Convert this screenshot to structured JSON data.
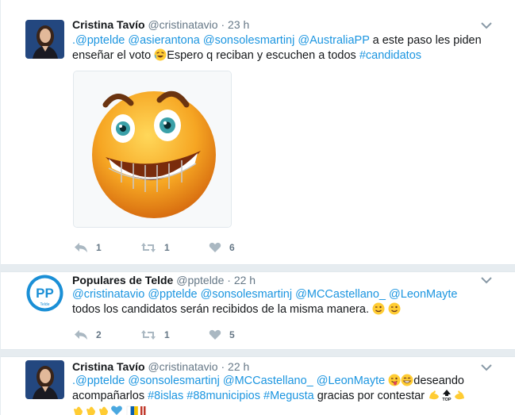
{
  "tweets": [
    {
      "name": "Cristina Tavío",
      "handle": "@cristinatavio",
      "dot": "·",
      "time": "23 h",
      "text_parts": [
        ".@pptelde",
        " ",
        "@asierantona",
        " ",
        "@sonsolesmartinj",
        " ",
        "@AustraliaPP",
        " a este paso les piden enseñar el voto ",
        "Espero q reciban y escuchen a todos ",
        "#candidatos"
      ],
      "reply_count": "1",
      "retweet_count": "1",
      "like_count": "6"
    },
    {
      "name": "Populares de Telde",
      "handle": "@pptelde",
      "dot": "·",
      "time": "22 h",
      "text_parts": [
        "@cristinatavio",
        " ",
        "@pptelde",
        " ",
        "@sonsolesmartinj",
        " ",
        "@MCCastellano_",
        " ",
        "@LeonMayte",
        "todos los candidatos serán recibidos de la misma manera. "
      ],
      "reply_count": "2",
      "retweet_count": "1",
      "like_count": "5",
      "avatar_logo_text": "PP",
      "avatar_logo_sub": "Telde"
    },
    {
      "name": "Cristina Tavío",
      "handle": "@cristinatavio",
      "dot": "·",
      "time": "22 h",
      "text_parts": [
        ".@pptelde",
        " ",
        "@sonsolesmartinj",
        " ",
        "@MCCastellano_",
        " ",
        "@LeonMayte",
        " ",
        "deseando",
        "acompañarlos ",
        "#8islas",
        " ",
        "#88municipios",
        " ",
        "#Megusta",
        " gracias por contestar "
      ]
    }
  ],
  "colors": {
    "link": "#1b95e0",
    "muted": "#657786",
    "separator": "#e6ecf0"
  },
  "icons": [
    "chevron-down-icon",
    "reply-icon",
    "retweet-icon",
    "heart-icon"
  ]
}
